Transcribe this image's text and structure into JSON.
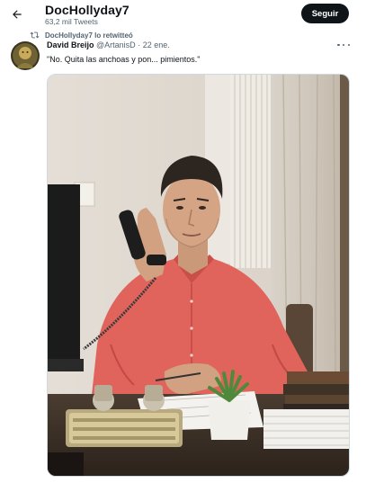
{
  "header": {
    "profile_name": "DocHollyday7",
    "tweet_count": "63,2 mil Tweets",
    "follow_label": "Seguir"
  },
  "retweet": {
    "text": "DocHollyday7 lo retwitteó"
  },
  "tweet": {
    "author_name": "David Breijo",
    "author_handle": "@ArtanisD",
    "separator": "·",
    "date": "22 ene.",
    "text": "\"No. Quita las anchoas y pon... pimientos.\""
  },
  "icons": {
    "back": "arrow-left-icon",
    "retweet": "retweet-icon",
    "more": "more-icon"
  },
  "colors": {
    "text_primary": "#0f1419",
    "text_secondary": "#536471",
    "button_bg": "#0f1419",
    "shirt": "#e0645c"
  }
}
